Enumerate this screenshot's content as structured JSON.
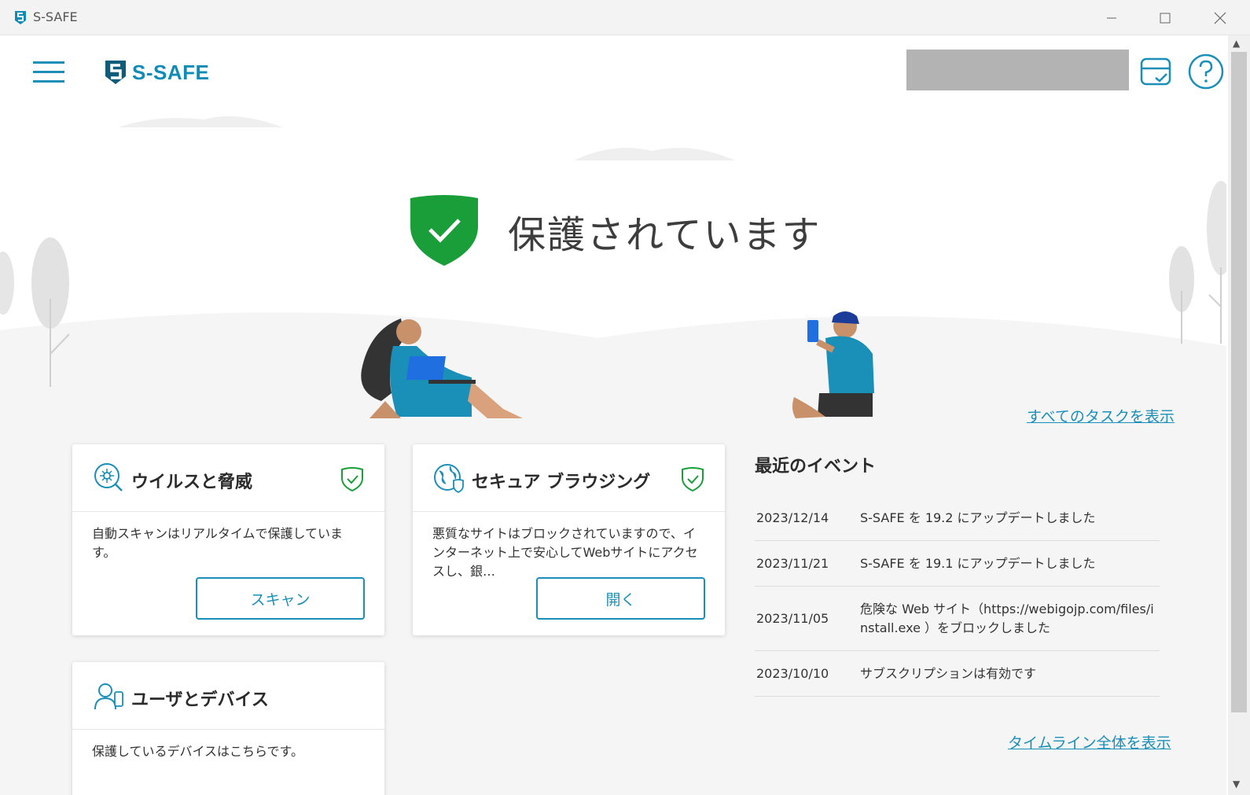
{
  "window": {
    "title": "S-SAFE"
  },
  "header": {
    "brand": "S-SAFE"
  },
  "hero": {
    "status": "保護されています",
    "all_tasks_link": "すべてのタスクを表示"
  },
  "cards": {
    "virus": {
      "title": "ウイルスと脅威",
      "description": "自動スキャンはリアルタイムで保護しています。",
      "button": "スキャン"
    },
    "browsing": {
      "title": "セキュア ブラウジング",
      "description": "悪質なサイトはブロックされていますので、インターネット上で安心してWebサイトにアクセスし、銀…",
      "button": "開く"
    },
    "users": {
      "title": "ユーザとデバイス",
      "description": "保護しているデバイスはこちらです。"
    }
  },
  "events": {
    "title": "最近のイベント",
    "items": [
      {
        "date": "2023/12/14",
        "text": "S-SAFE を 19.2 にアップデートしました"
      },
      {
        "date": "2023/11/21",
        "text": "S-SAFE を 19.1 にアップデートしました"
      },
      {
        "date": "2023/11/05",
        "text": "危険な Web サイト（https://webigojp.com/files/install.exe ）をブロックしました"
      },
      {
        "date": "2023/10/10",
        "text": "サブスクリプションは有効です"
      }
    ],
    "timeline_link": "タイムライン全体を表示"
  },
  "colors": {
    "accent": "#1a8fb7",
    "brand": "#0f8bb5",
    "shield": "#1a9e3a"
  },
  "icons": {
    "hamburger": "menu-icon",
    "subscription": "card-check-icon",
    "help": "question-icon",
    "virus": "virus-scan-icon",
    "browsing": "globe-shield-icon",
    "users": "user-device-icon",
    "check": "shield-check-icon"
  }
}
